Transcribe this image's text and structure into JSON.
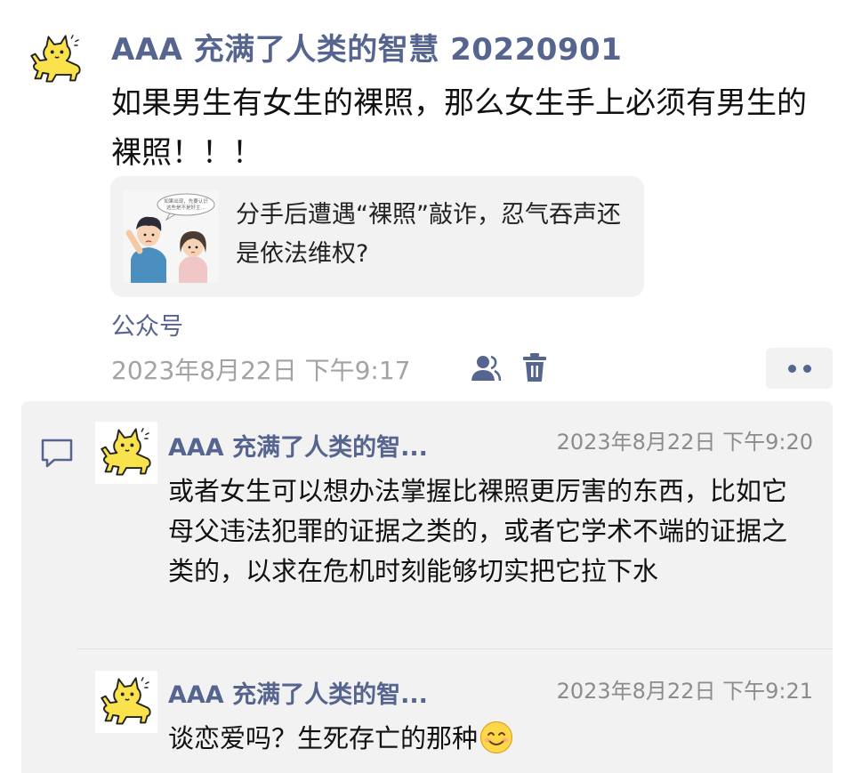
{
  "post": {
    "author": "AAA 充满了人类的智慧 20220901",
    "text": "如果男生有女生的裸照，那么女生手上必须有男生的裸照！！！",
    "share_card": {
      "title": "分手后遭遇“裸照”敲诈，忍气吞声还是依法维权?",
      "thumb_bubble_text": "如果出现，先要认识 这些是不是好主…"
    },
    "source": "公众号",
    "timestamp": "2023年8月22日 下午9:17"
  },
  "comments": [
    {
      "author": "AAA 充满了人类的智...",
      "time": "2023年8月22日 下午9:20",
      "text": "或者女生可以想办法掌握比裸照更厉害的东西，比如它母父违法犯罪的证据之类的，或者它学术不端的证据之类的，以求在危机时刻能够切实把它拉下水"
    },
    {
      "author": "AAA 充满了人类的智...",
      "time": "2023年8月22日 下午9:21",
      "text": "谈恋爱吗？生死存亡的那种",
      "emoji": "smiling-face-icon"
    }
  ],
  "colors": {
    "name_blue": "#56658f",
    "panel_gray": "#f2f2f2",
    "meta_gray": "#a3a3a3",
    "text": "#111111"
  },
  "icons": [
    "cat-avatar-icon",
    "people-icon",
    "trash-icon",
    "more-dots-icon",
    "comment-icon",
    "smiling-face-icon"
  ]
}
